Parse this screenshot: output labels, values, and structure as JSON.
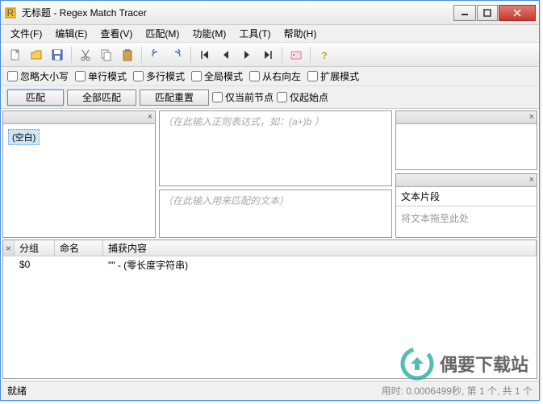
{
  "title": "无标题 - Regex Match Tracer",
  "menu": [
    "文件(F)",
    "编辑(E)",
    "查看(V)",
    "匹配(M)",
    "功能(M)",
    "工具(T)",
    "帮助(H)"
  ],
  "options": [
    "忽略大小写",
    "单行模式",
    "多行模式",
    "全局模式",
    "从右向左",
    "扩展模式"
  ],
  "buttons": {
    "match": "匹配",
    "match_all": "全部匹配",
    "match_reset": "匹配重置",
    "only_cur_node": "仅当前节点",
    "only_start": "仅起始点"
  },
  "tree": {
    "root": "(空白)"
  },
  "placeholders": {
    "regex": "（在此输入正则表达式，如：(a+)b ）",
    "text": "（在此输入用来匹配的文本）"
  },
  "snippet": {
    "title": "文本片段",
    "hint": "将文本拖至此处"
  },
  "table": {
    "headers": [
      "分组",
      "命名",
      "捕获内容"
    ],
    "rows": [
      {
        "group": "$0",
        "name": "",
        "content": "\"\" - (零长度字符串)"
      }
    ]
  },
  "status": {
    "ready": "就绪",
    "right": "用时: 0.0006499秒, 第 1 个, 共 1 个"
  },
  "watermark": "偶要下载站",
  "icons": {
    "close_x": "×",
    "minus": "—"
  }
}
